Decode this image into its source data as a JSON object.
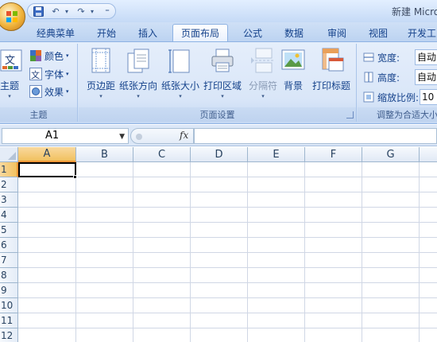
{
  "window": {
    "title": "新建 Micro"
  },
  "qat": {
    "undo_label": "↶",
    "redo_label": "↷",
    "dropdown_label": "▾",
    "customize_label": "⁼"
  },
  "tabs": [
    {
      "label": "经典菜单"
    },
    {
      "label": "开始"
    },
    {
      "label": "插入"
    },
    {
      "label": "页面布局",
      "active": true
    },
    {
      "label": "公式"
    },
    {
      "label": "数据"
    },
    {
      "label": "审阅"
    },
    {
      "label": "视图"
    },
    {
      "label": "开发工"
    }
  ],
  "ribbon": {
    "theme_group": {
      "label": "主题",
      "themes_label": "主题",
      "colors_label": "颜色",
      "fonts_label": "字体",
      "effects_label": "效果",
      "dropdown": "▾"
    },
    "page_setup_group": {
      "label": "页面设置",
      "buttons": [
        {
          "label": "页边距",
          "icon": "margins-icon"
        },
        {
          "label": "纸张方向",
          "icon": "orientation-icon"
        },
        {
          "label": "纸张大小",
          "icon": "paper-size-icon"
        },
        {
          "label": "打印区域",
          "icon": "print-area-icon"
        },
        {
          "label": "分隔符",
          "icon": "breaks-icon",
          "disabled": true
        },
        {
          "label": "背景",
          "icon": "background-icon"
        },
        {
          "label": "打印标题",
          "icon": "print-titles-icon"
        }
      ]
    },
    "scale_group": {
      "label": "调整为合适大小",
      "width_label": "宽度:",
      "width_value": "自动",
      "height_label": "高度:",
      "height_value": "自动",
      "scale_label": "缩放比例:",
      "scale_value": "10"
    }
  },
  "formula_bar": {
    "name_box": "A1",
    "fx": "fx",
    "formula": ""
  },
  "grid": {
    "columns": [
      "A",
      "B",
      "C",
      "D",
      "E",
      "F",
      "G"
    ],
    "rows": [
      "1",
      "2",
      "3",
      "4",
      "5",
      "6",
      "7",
      "8",
      "9",
      "10",
      "11",
      "12"
    ],
    "selected_cell": "A1"
  },
  "colors": {
    "selected_header": "#f1c15f",
    "ribbon_bg": "#dfe9f8",
    "accent": "#15428b"
  }
}
